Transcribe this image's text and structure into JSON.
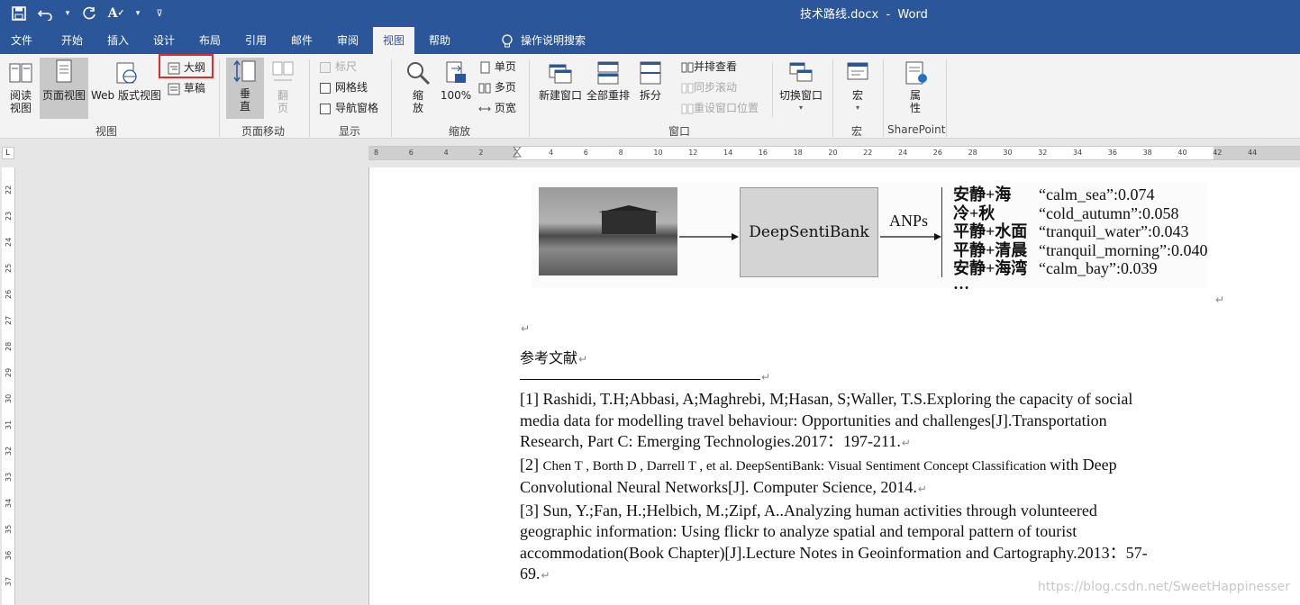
{
  "window": {
    "title": "技术路线.docx",
    "app": "Word",
    "title_sep": "  -  "
  },
  "tabs": [
    "文件",
    "开始",
    "插入",
    "设计",
    "布局",
    "引用",
    "邮件",
    "审阅",
    "视图",
    "帮助"
  ],
  "active_tab": "视图",
  "tell_me": "操作说明搜索",
  "ribbon": {
    "views": {
      "label": "视图",
      "read": "阅读\n视图",
      "print": "页面视图",
      "web": "Web 版式视图",
      "outline": "大纲",
      "draft": "草稿"
    },
    "page_move": {
      "label": "页面移动",
      "vertical": "垂\n直",
      "side": "翻\n页"
    },
    "show": {
      "label": "显示",
      "ruler": "标尺",
      "gridlines": "网格线",
      "nav": "导航窗格"
    },
    "zoom": {
      "label": "缩放",
      "zoom": "缩\n放",
      "pct": "100%",
      "one": "单页",
      "multi": "多页",
      "width": "页宽"
    },
    "window": {
      "label": "窗口",
      "new": "新建窗口",
      "arrange": "全部重排",
      "split": "拆分",
      "side": "并排查看",
      "sync": "同步滚动",
      "reset": "重设窗口位置",
      "switch": "切换窗口"
    },
    "macros": {
      "label": "宏",
      "macro": "宏"
    },
    "sharepoint": {
      "label": "SharePoint",
      "props": "属\n性"
    }
  },
  "ruler": {
    "h_ticks": [
      "8",
      "6",
      "4",
      "2",
      "2",
      "4",
      "6",
      "8",
      "10",
      "12",
      "14",
      "16",
      "18",
      "20",
      "22",
      "24",
      "26",
      "28",
      "30",
      "32",
      "34",
      "36",
      "38",
      "40",
      "42",
      "44"
    ],
    "v_ticks": [
      "22",
      "23",
      "24",
      "25",
      "26",
      "27",
      "28",
      "29",
      "30",
      "31",
      "32",
      "33",
      "34",
      "35",
      "36",
      "37"
    ]
  },
  "figure": {
    "box_label": "DeepSentiBank",
    "arrow_label": "ANPs",
    "anps": [
      {
        "zh": "安静+海",
        "en": "“calm_sea”:0.074"
      },
      {
        "zh": "冷+秋",
        "en": "“cold_autumn”:0.058"
      },
      {
        "zh": "平静+水面",
        "en": "“tranquil_water”:0.043"
      },
      {
        "zh": "平静+清晨",
        "en": "“tranquil_morning”:0.040"
      },
      {
        "zh": "安静+海湾",
        "en": "“calm_bay”:0.039"
      },
      {
        "zh": "…",
        "en": ""
      }
    ]
  },
  "doc": {
    "para_mark": "↵",
    "heading": "参考文献",
    "refs": [
      "[1] Rashidi, T.H;Abbasi, A;Maghrebi, M;Hasan, S;Waller, T.S.Exploring the capacity of social",
      "media data for modelling travel behaviour: Opportunities and challenges[J].Transportation",
      "Research, Part C: Emerging Technologies.2017：197-211.",
      "[2] ",
      "Chen T , Borth D , Darrell T , et al. DeepSentiBank: Visual Sentiment Concept Classification ",
      "with Deep",
      "Convolutional Neural Networks[J]. Computer Science, 2014.",
      "[3] Sun, Y.;Fan, H.;Helbich, M.;Zipf, A..Analyzing human activities through volunteered",
      "geographic information: Using flickr to analyze spatial and temporal pattern of tourist",
      "accommodation(Book Chapter)[J].Lecture Notes in Geoinformation and Cartography.2013：57-",
      "69."
    ]
  },
  "watermark": "https://blog.csdn.net/SweetHappinesser",
  "colors": {
    "title_blue": "#2b579a",
    "ribbon_bg": "#f3f3f3",
    "highlight_red": "#e52a2a"
  }
}
